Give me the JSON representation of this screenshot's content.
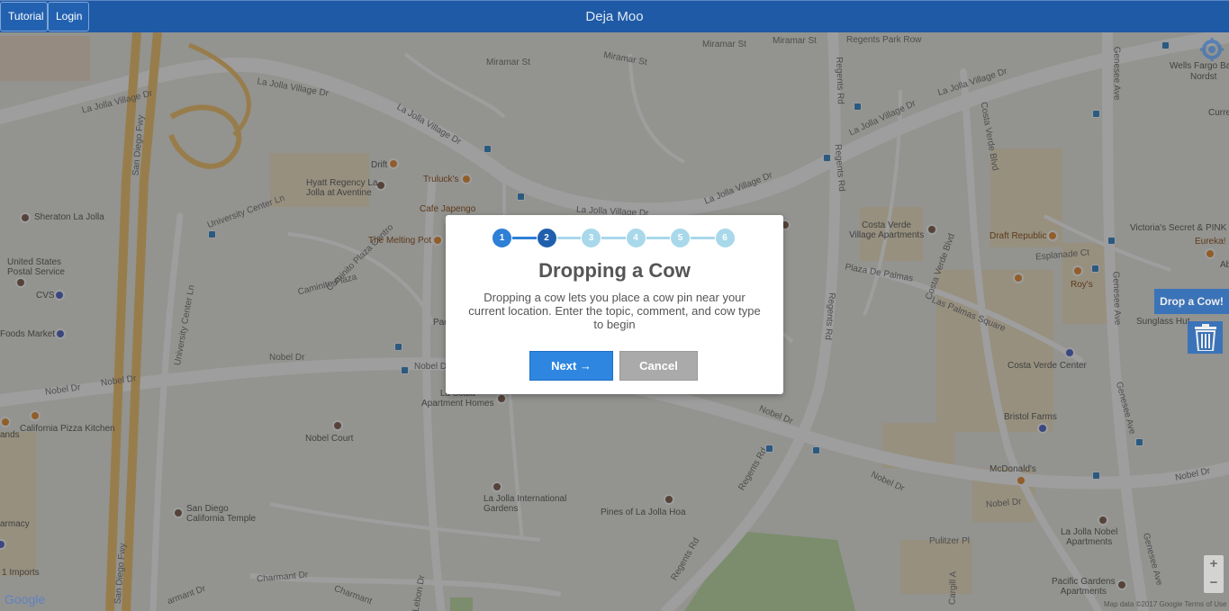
{
  "header": {
    "title": "Deja Moo",
    "tutorial_label": "Tutorial",
    "login_label": "Login"
  },
  "modal": {
    "steps": [
      "1",
      "2",
      "3",
      "4",
      "5",
      "6"
    ],
    "current_step": 2,
    "title": "Dropping a Cow",
    "body": "Dropping a cow lets you place a cow pin near your current location. Enter the topic, comment, and cow type to begin",
    "next_label": "Next →",
    "cancel_label": "Cancel"
  },
  "controls": {
    "drop_cow_label": "Drop a Cow!",
    "zoom_in": "+",
    "zoom_out": "−",
    "google": "Google",
    "footer": "Map data ©2017 Google   Terms of Use"
  },
  "map": {
    "roads": {
      "la_jolla_village_dr_1": "La Jolla Village Dr",
      "la_jolla_village_dr_2": "La Jolla Village Dr",
      "la_jolla_village_dr_3": "La Jolla Village Dr",
      "la_jolla_village_dr_4": "La Jolla Village Dr",
      "la_jolla_village_dr_5": "La Jolla Village Dr",
      "la_jolla_village_dr_6": "La Jolla Village Dr",
      "san_diego_fwy_1": "San Diego Fwy",
      "san_diego_fwy_2": "San Diego Fwy",
      "miramar_1": "Miramar St",
      "miramar_2": "Miramar St",
      "miramar_3": "Miramar St",
      "miramar_4": "Miramar St",
      "regents_park_row": "Regents Park Row",
      "regents_rd_1": "Regents Rd",
      "regents_rd_2": "Regents Rd",
      "regents_rd_3": "Regents Rd",
      "regents_rd_4": "Regents Rd",
      "regents_rd_5": "Regents Rd",
      "genesee_1": "Genesee Ave",
      "genesee_2": "Genesee Ave",
      "genesee_3": "Genesee Ave",
      "genesee_4": "Genesee Ave",
      "costa_verde_blvd_1": "Costa Verde Blvd",
      "costa_verde_blvd_2": "Costa Verde Blvd",
      "university_center_ln_1": "University Center Ln",
      "university_center_ln_2": "University Center Ln",
      "caminito_plaza_centro": "Caminito Plaza Centro",
      "caminito_plaza": "Caminito Plaza",
      "nobel_dr_1": "Nobel Dr",
      "nobel_dr_2": "Nobel Dr",
      "nobel_dr_3": "Nobel Dr",
      "nobel_dr_4": "Nobel Dr",
      "nobel_dr_5": "Nobel Dr",
      "nobel_dr_6": "Nobel Dr",
      "nobel_dr_7": "Nobel Dr",
      "nobel_dr_8": "Nobel D",
      "plaza_de_palmas": "Plaza De Palmas",
      "las_palmas_square": "Las Palmas Square",
      "esplanade_ct": "Esplanade Ct",
      "pulitzer_pl": "Pulitzer Pl",
      "charmant_dr_1": "Charmant Dr",
      "charmant_dr_2": "Charmant",
      "charmant_dr_3": "armant Dr",
      "lebon_dr": "Lebon Dr",
      "caminito": "Caminito",
      "cargill": "Cargill A"
    },
    "places": {
      "drift": "Drift",
      "hyatt": "Hyatt Regency La\nJolla at Aventine",
      "truluck": "Truluck's",
      "cafe_japengo": "Cafe Japengo",
      "melting_pot": "The Melting Pot",
      "sheraton": "Sheraton La Jolla",
      "usps": "United States\nPostal Service",
      "cvs": "CVS",
      "foods_market": "Foods Market",
      "cpk": "California Pizza Kitchen",
      "lands": "ands",
      "nobel_court": "Nobel Court",
      "la_scala": "La Scala\nApartment Homes",
      "la_jolla_intl": "La Jolla International\nGardens",
      "pines": "Pines of La Jolla Hoa",
      "sd_temple": "San Diego\nCalifornia Temple",
      "pharmacy": "armacy",
      "imports": "1 Imports",
      "costa_verde_village": "Costa Verde\nVillage Apartments",
      "draft_republic": "Draft Republic",
      "roys": "Roy's",
      "costa_verde_center": "Costa Verde Center",
      "bristol": "Bristol Farms",
      "mcdonalds": "McDonald's",
      "la_jolla_nobel": "La Jolla Nobel\nApartments",
      "pacific_gardens": "Pacific Gardens\nApartments",
      "victorias": "Victoria's Secret & PINK",
      "eureka": "Eureka!",
      "ab": "Ab",
      "sunglass": "Sunglass Hut",
      "wells": "Wells Fargo Ban",
      "nordst": "Nordst",
      "curr": "Curre",
      "pac": "Pac"
    }
  }
}
